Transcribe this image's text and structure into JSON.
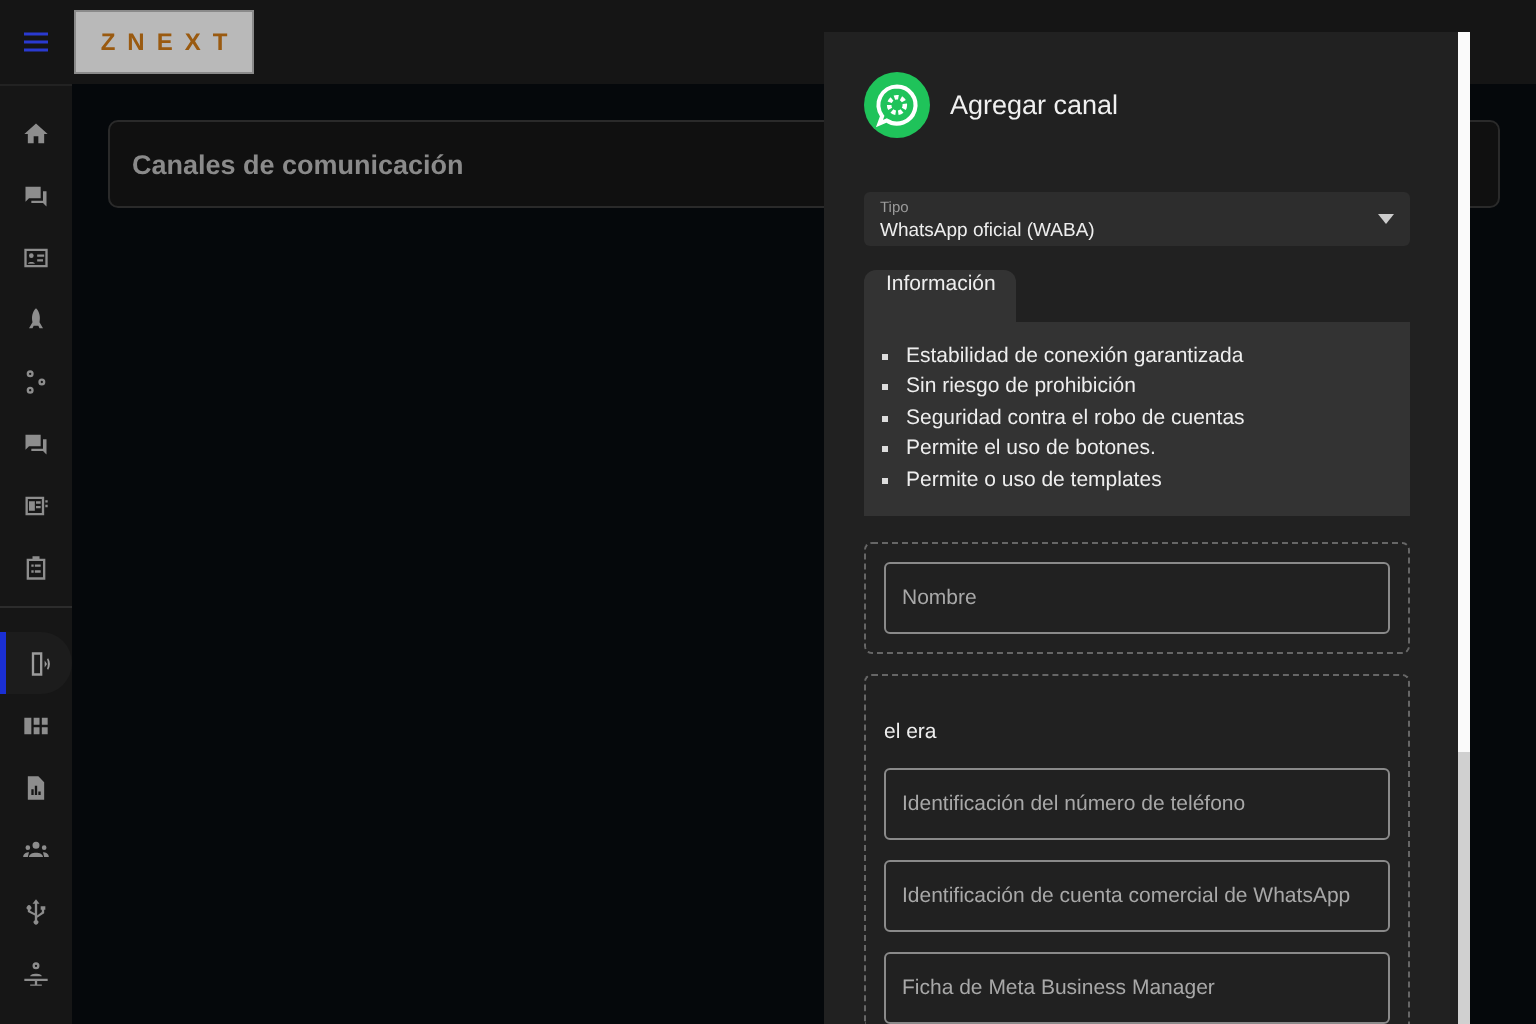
{
  "topbar": {
    "logo": "ZNEXT"
  },
  "sidebar": {
    "groups": [
      {
        "items": [
          {
            "kind": "home",
            "selected": false
          },
          {
            "kind": "chat",
            "selected": false
          },
          {
            "kind": "contact",
            "selected": false
          },
          {
            "kind": "rocket",
            "selected": false
          },
          {
            "kind": "nodes",
            "selected": false
          },
          {
            "kind": "chat",
            "selected": false
          },
          {
            "kind": "news",
            "selected": false
          },
          {
            "kind": "clipboard",
            "selected": false
          }
        ]
      },
      {
        "items": [
          {
            "kind": "phone",
            "selected": true
          },
          {
            "kind": "dashboard",
            "selected": false
          },
          {
            "kind": "report",
            "selected": false
          },
          {
            "kind": "group",
            "selected": false
          },
          {
            "kind": "usb",
            "selected": false
          },
          {
            "kind": "desk",
            "selected": false
          }
        ]
      }
    ]
  },
  "page": {
    "title": "Canales de comunicación"
  },
  "dialog": {
    "title": "Agregar canal",
    "type_field": {
      "label": "Tipo",
      "value": "WhatsApp oficial (WABA)"
    },
    "info_tab": "Información",
    "benefits": [
      "Estabilidad de conexión garantizada",
      "Sin riesgo de prohibición",
      "Seguridad contra el robo de cuentas",
      "Permite el uso de botones.",
      "Permite o uso de templates"
    ],
    "name_field": {
      "placeholder": "Nombre"
    },
    "credentials": {
      "title": "el era",
      "fields": [
        {
          "placeholder": "Identificación del número de teléfono"
        },
        {
          "placeholder": "Identificación de cuenta comercial de WhatsApp"
        },
        {
          "placeholder": "Ficha de Meta Business Manager"
        }
      ]
    }
  }
}
